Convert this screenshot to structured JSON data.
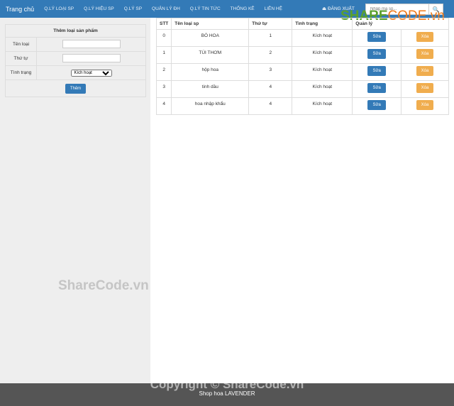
{
  "nav": {
    "brand": "Trang chủ",
    "items": [
      "Q.LÝ LOẠI SP",
      "Q.LÝ HIỆU SP",
      "Q.LÝ SP",
      "QUẢN LÝ ĐH",
      "Q.LÝ TIN TỨC",
      "THỐNG KÊ",
      "LIÊN HỆ"
    ],
    "logout": "⏏ ĐĂNG XUẤT",
    "search_placeholder": "Nhập mã sp...",
    "search_icon": "search-icon"
  },
  "form": {
    "title": "Thêm loại sản phẩm",
    "name_label": "Tên loại",
    "order_label": "Thứ tự",
    "status_label": "Tình trạng",
    "status_value": "Kích hoạt",
    "submit": "Thêm"
  },
  "table": {
    "headers": [
      "STT",
      "Tên loại sp",
      "Thứ tự",
      "Tình trạng",
      "Quản lý"
    ],
    "rows": [
      {
        "stt": "0",
        "name": "BÓ HOA",
        "order": "1",
        "status": "Kích hoạt"
      },
      {
        "stt": "1",
        "name": "TÚI THƠM",
        "order": "2",
        "status": "Kích hoạt"
      },
      {
        "stt": "2",
        "name": "hộp hoa",
        "order": "3",
        "status": "Kích hoạt"
      },
      {
        "stt": "3",
        "name": "tinh dầu",
        "order": "4",
        "status": "Kích hoạt"
      },
      {
        "stt": "4",
        "name": "hoa nhập khẩu",
        "order": "4",
        "status": "Kích hoạt"
      }
    ],
    "edit": "Sửa",
    "delete": "Xóa"
  },
  "watermark": {
    "logo": "SHARECODE.vn",
    "side": "ShareCode.vn",
    "footer": "Copyright © ShareCode.vn"
  },
  "footer": {
    "text": "Shop hoa LAVENDER"
  },
  "colors": {
    "primary": "#337ab7",
    "warning": "#f0ad4e",
    "footer": "#555555"
  }
}
